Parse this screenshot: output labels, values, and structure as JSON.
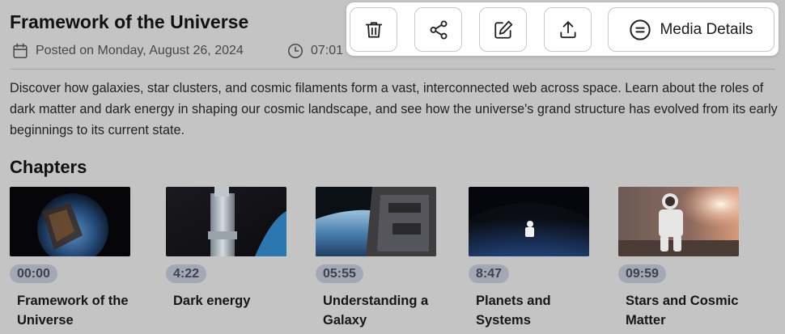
{
  "post": {
    "title": "Framework of the Universe",
    "posted": "Posted on Monday, August 26, 2024",
    "time": "07:01",
    "description": "Discover how galaxies, star clusters, and cosmic filaments form a vast, interconnected web across space. Learn about the roles of dark matter and dark energy in shaping our cosmic landscape, and see how the universe's grand structure has evolved from its early beginnings to its current state."
  },
  "chapters_heading": "Chapters",
  "chapters": [
    {
      "time": "00:00",
      "title": "Framework of the Universe"
    },
    {
      "time": "4:22",
      "title": "Dark energy"
    },
    {
      "time": "05:55",
      "title": "Understanding a Galaxy"
    },
    {
      "time": "8:47",
      "title": "Planets and Systems"
    },
    {
      "time": "09:59",
      "title": "Stars and Cosmic Matter"
    }
  ],
  "toolbar": {
    "delete_icon": "trash-icon",
    "share_icon": "share-icon",
    "edit_icon": "edit-icon",
    "upload_icon": "upload-icon",
    "media_details_icon": "equals-icon",
    "media_details_label": "Media Details"
  },
  "colors": {
    "background": "#c4c4c4",
    "toolbar_bg": "#ffffff",
    "time_badge_bg": "#a4a8b5"
  }
}
